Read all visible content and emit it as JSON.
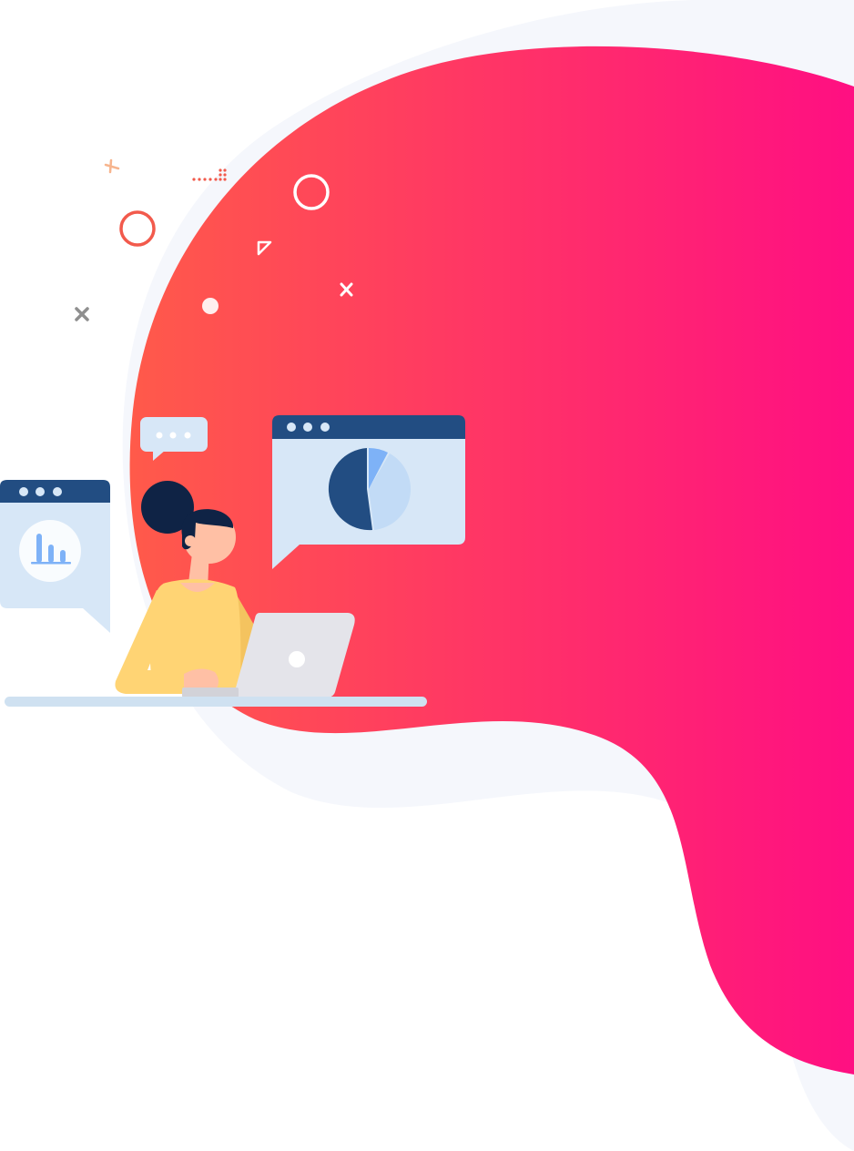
{
  "scene": {
    "background_color": "#ffffff",
    "light_blob_color": "#f5f7fc",
    "gradient_start_color": "#ff5a4a",
    "gradient_end_color": "#ff0f82",
    "illustration": "woman-working-on-laptop",
    "charts_shown": [
      "pie-chart",
      "bar-chart"
    ]
  },
  "palette": {
    "window_header": "#224d82",
    "window_body": "#d7e7f7",
    "pie_dark": "#224d82",
    "pie_mid": "#c2dbf6",
    "pie_light": "#7eb2f7",
    "shirt": "#ffd474",
    "skin": "#ffc0a5",
    "hair": "#0f2345",
    "laptop": "#e4e4ea",
    "desk": "#cfe1f1",
    "coral": "#f25a4c",
    "peach": "#f7b58e",
    "gray": "#8f8f8f"
  }
}
